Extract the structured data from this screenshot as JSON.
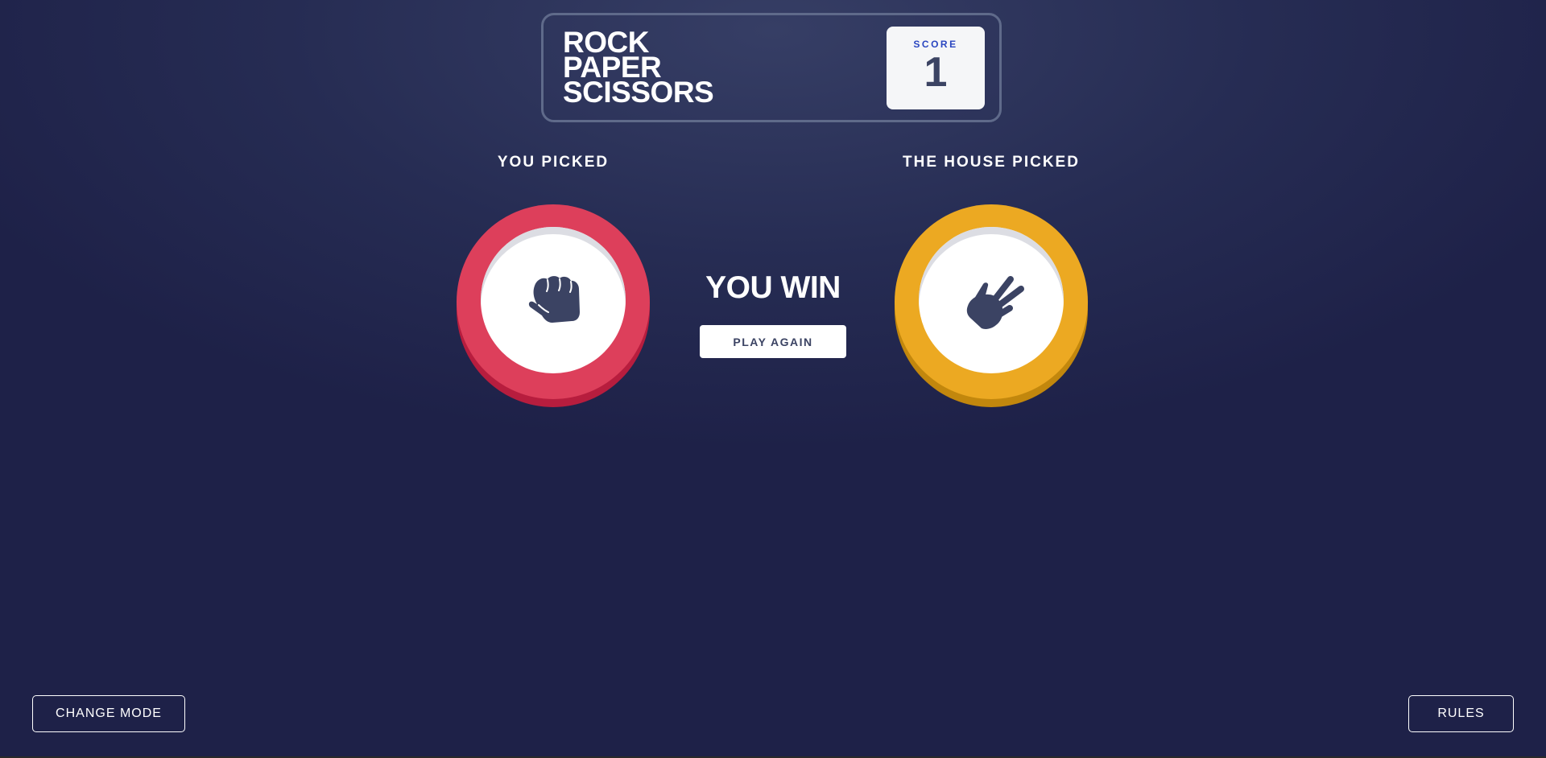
{
  "header": {
    "title_lines": [
      "ROCK",
      "PAPER",
      "SCISSORS"
    ],
    "score_label": "SCORE",
    "score_value": "1"
  },
  "game": {
    "you_picked_label": "YOU PICKED",
    "house_picked_label": "THE HOUSE PICKED",
    "player_choice": {
      "name": "rock",
      "icon": "rock-fist-icon",
      "ring_color": "#dd3f5b"
    },
    "house_choice": {
      "name": "scissors",
      "icon": "scissors-hand-icon",
      "ring_color": "#eca922"
    },
    "result_text": "YOU WIN",
    "play_again_label": "PLAY AGAIN"
  },
  "footer": {
    "change_mode_label": "CHANGE MODE",
    "rules_label": "RULES"
  },
  "colors": {
    "background": "#262c53",
    "header_outline": "#5f6a8a",
    "score_label": "#2a46c0",
    "dark_text": "#3b4363",
    "rock": "#dd3f5b",
    "scissors": "#eca922"
  }
}
